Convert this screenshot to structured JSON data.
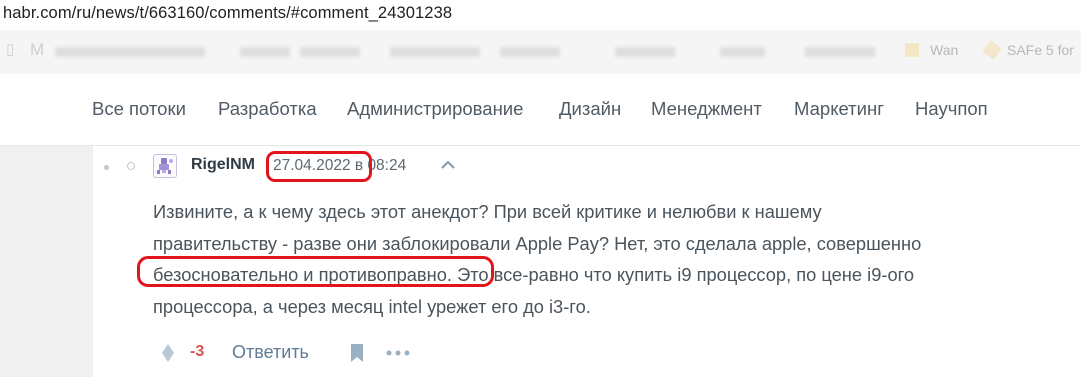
{
  "browser": {
    "url": "habr.com/ru/news/t/663160/comments/#comment_24301238",
    "bookmarks": {
      "first_initial": "M",
      "right_items": [
        "Wan",
        "SAFe 5 for"
      ]
    }
  },
  "nav": {
    "items": [
      "Все потоки",
      "Разработка",
      "Администрирование",
      "Дизайн",
      "Менеджмент",
      "Маркетинг",
      "Научпоп"
    ]
  },
  "comment": {
    "author": "RigelNM",
    "date": "27.04.2022",
    "at": "в",
    "time": "08:24",
    "body_lines": [
      "Извините, а к чему здесь этот анекдот? При всей критике и нелюбви к нашему",
      "правительству - разве они заблокировали Apple Pay? Нет, это сделала apple, совершенно"
    ],
    "body_line3_highlight": "безосновательно и противоправно",
    "body_line3_rest": ". Это все-равно что купить i9 процессор, по цене i9-ого",
    "body_line4": "процессора, а через месяц intel урежет его до i3-го.",
    "score": "-3",
    "reply_label": "Ответить"
  },
  "colors": {
    "highlight_ring": "#e2141c",
    "score_negative": "#d9534f",
    "link": "#5e7a94"
  }
}
